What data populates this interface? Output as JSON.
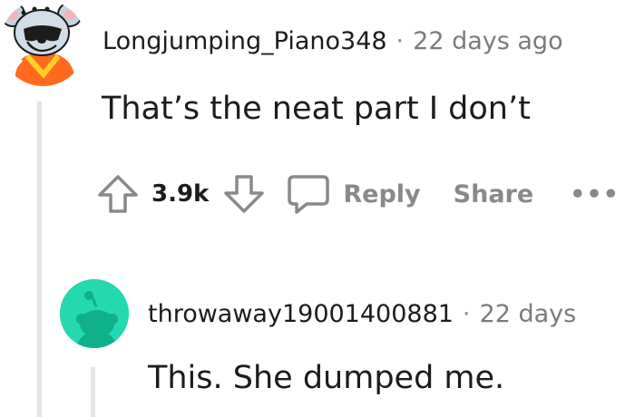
{
  "comments": [
    {
      "username": "Longjumping_Piano348",
      "separator": "·",
      "timestamp": "22 days ago",
      "body": "That’s the neat part I don’t",
      "avatar_icon": "koala-avatar-icon",
      "votes": "3.9k",
      "actions": {
        "reply": "Reply",
        "share": "Share",
        "more": "•••"
      }
    },
    {
      "username": "throwaway19001400881",
      "separator": "·",
      "timestamp": "22 days",
      "body": "This. She dumped me.",
      "avatar_icon": "default-snoo-avatar-icon"
    }
  ],
  "colors": {
    "text": "#1c1c1c",
    "meta": "#787c7e",
    "action": "#878a8c",
    "thread_line": "#e5e5e5",
    "snoo_bg": "#24d8b0",
    "snoo_body": "#0fb08a"
  }
}
